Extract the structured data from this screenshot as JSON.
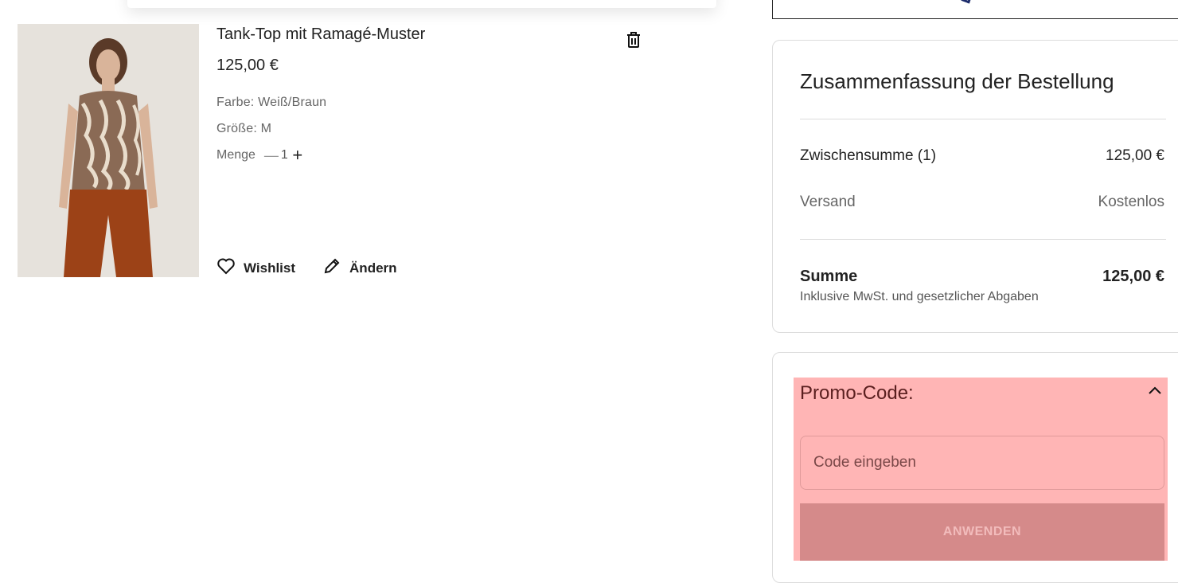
{
  "cart_item": {
    "title": "Tank-Top mit Ramagé-Muster",
    "price": "125,00 €",
    "color_label": "Farbe: Weiß/Braun",
    "size_label": "Größe: M",
    "quantity_label": "Menge",
    "quantity_minus": "—",
    "quantity": "1",
    "quantity_plus": "+",
    "wishlist_label": "Wishlist",
    "edit_label": "Ändern"
  },
  "summary": {
    "title": "Zusammenfassung der Bestellung",
    "subtotal_label": "Zwischensumme (1)",
    "subtotal_value": "125,00 €",
    "shipping_label": "Versand",
    "shipping_value": "Kostenlos",
    "total_label": "Summe",
    "total_value": "125,00 €",
    "total_note": "Inklusive MwSt. und gesetzlicher Abgaben"
  },
  "promo": {
    "title": "Promo-Code:",
    "input_placeholder": "Code eingeben",
    "apply_label": "ANWENDEN"
  },
  "icons": {
    "delete": "trash-icon",
    "wishlist": "heart-icon",
    "edit": "pencil-icon",
    "collapse": "chevron-up-icon"
  },
  "colors": {
    "highlight": "#ff7878",
    "apply_button": "#d58a8a"
  }
}
